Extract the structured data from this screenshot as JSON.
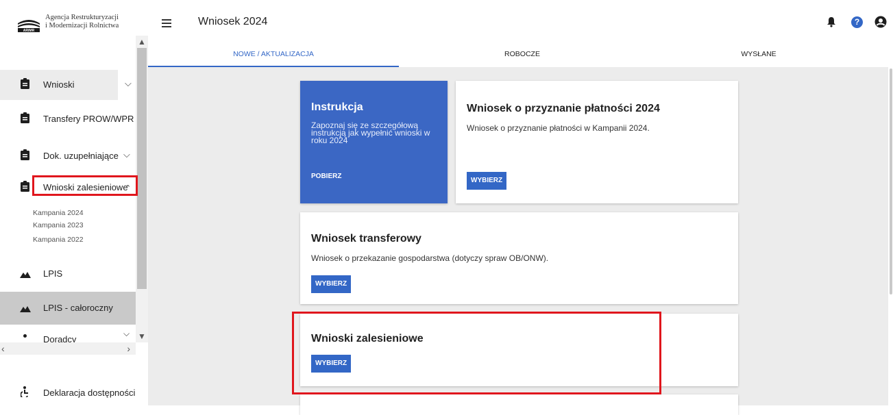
{
  "app": {
    "logo_line1": "Agencja Restrukturyzacji",
    "logo_line2": "i Modernizacji Rolnictwa",
    "logo_abbr": "ARiMR",
    "title": "Wniosek 2024"
  },
  "sidebar": {
    "items": [
      {
        "label": "Wnioski",
        "chevron": "⌄"
      },
      {
        "label": "Transfery PROW/WPR"
      },
      {
        "label": "Dok. uzupełniające",
        "chevron": "⌄"
      },
      {
        "label": "Wnioski zalesieniowe",
        "chevron": "⌃"
      },
      {
        "label": "LPIS"
      },
      {
        "label": "LPIS - całoroczny"
      },
      {
        "label": "Doradcy"
      }
    ],
    "subitems": [
      "Kampania 2024",
      "Kampania 2023",
      "Kampania 2022"
    ],
    "footer": "Deklaracja dostępności"
  },
  "tabs": [
    {
      "label": "NOWE / AKTUALIZACJA"
    },
    {
      "label": "ROBOCZE"
    },
    {
      "label": "WYSŁANE"
    }
  ],
  "cards": {
    "instr": {
      "title": "Instrukcja",
      "text": "Zapoznaj się ze szczegółową instrukcją jak wypełnić wnioski w roku 2024",
      "link": "POBIERZ"
    },
    "payment": {
      "title": "Wniosek o przyznanie płatności 2024",
      "text": "Wniosek o przyznanie płatności w Kampanii 2024.",
      "button": "WYBIERZ"
    },
    "transfer": {
      "title": "Wniosek transferowy",
      "text": "Wniosek o przekazanie gospodarstwa (dotyczy spraw OB/ONW).",
      "button": "WYBIERZ"
    },
    "forest": {
      "title": "Wnioski zalesieniowe",
      "button": "WYBIERZ"
    }
  },
  "colors": {
    "accent": "#3367c6",
    "highlight": "#e0161d",
    "background": "#ececec"
  }
}
